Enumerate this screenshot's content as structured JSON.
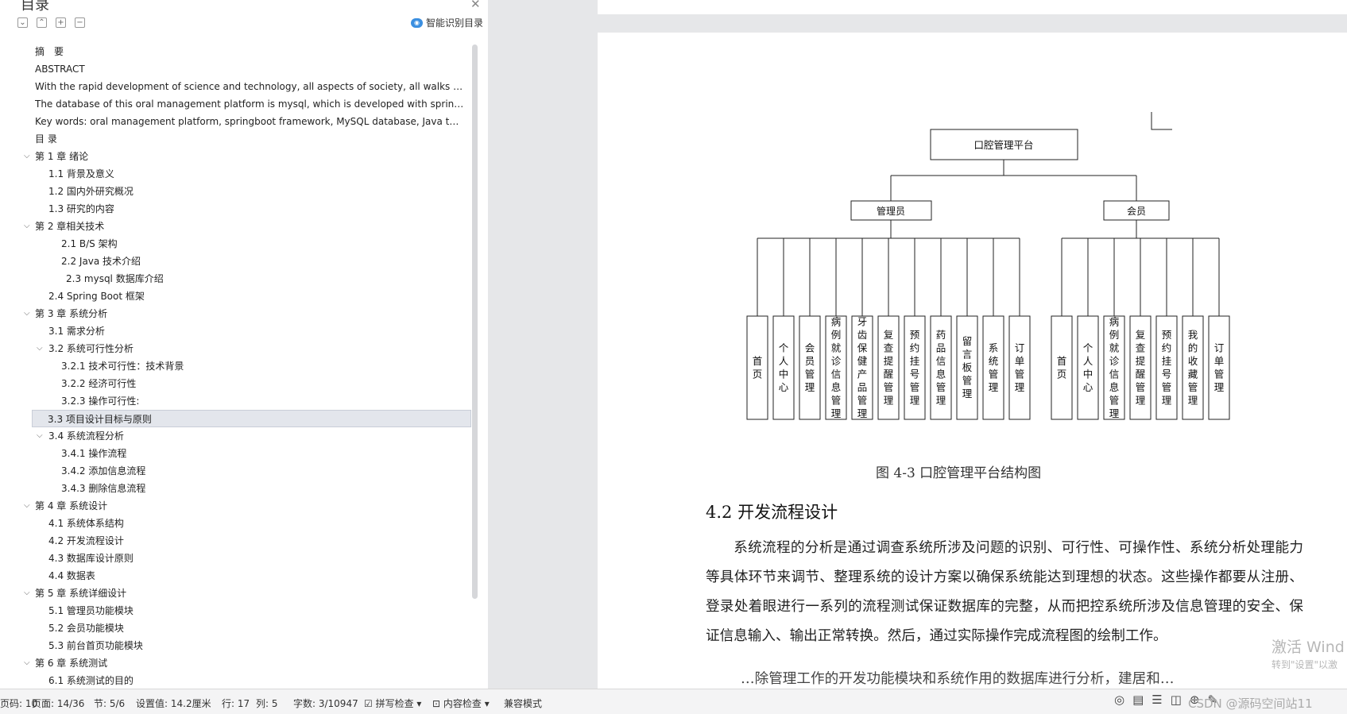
{
  "toc": {
    "title": "目录",
    "smart_label": "智能识别目录",
    "items": [
      {
        "label": "摘　要",
        "level": 0,
        "chev": false
      },
      {
        "label": "ABSTRACT",
        "level": 0,
        "chev": false
      },
      {
        "label": "With the rapid development of science and technology, all aspects of society, all walks of lif ...",
        "level": 0,
        "chev": false
      },
      {
        "label": "The database of this oral management platform is mysql, which is developed with springbo...",
        "level": 0,
        "chev": false
      },
      {
        "label": "Key words: oral management platform, springboot framework, MySQL database, Java techn...",
        "level": 0,
        "chev": false
      },
      {
        "label": "目 录",
        "level": 0,
        "chev": false
      },
      {
        "label": "第 1 章  绪论",
        "level": 0,
        "chev": true
      },
      {
        "label": "1.1 背景及意义",
        "level": 1,
        "chev": false
      },
      {
        "label": "1.2  国内外研究概况",
        "level": 1,
        "chev": false
      },
      {
        "label": "1.3  研究的内容",
        "level": 1,
        "chev": false
      },
      {
        "label": "第 2 章相关技术",
        "level": 0,
        "chev": true
      },
      {
        "label": "2.1    B/S 架构",
        "level": 2,
        "chev": false
      },
      {
        "label": "2.2    Java 技术介绍",
        "level": 2,
        "chev": false
      },
      {
        "label": "2.3 mysql 数据库介绍",
        "level": 3,
        "chev": false
      },
      {
        "label": "2.4 Spring    Boot 框架",
        "level": 1,
        "chev": false
      },
      {
        "label": "第 3 章  系统分析",
        "level": 0,
        "chev": true
      },
      {
        "label": "3.1  需求分析",
        "level": 1,
        "chev": false
      },
      {
        "label": "3.2  系统可行性分析",
        "level": 1,
        "chev": true
      },
      {
        "label": "3.2.1 技术可行性：技术背景",
        "level": 2,
        "chev": false
      },
      {
        "label": "3.2.2 经济可行性",
        "level": 2,
        "chev": false
      },
      {
        "label": "3.2.3 操作可行性:",
        "level": 2,
        "chev": false
      },
      {
        "label": "3.3  项目设计目标与原则",
        "level": 1,
        "chev": false,
        "sel": true
      },
      {
        "label": "3.4 系统流程分析",
        "level": 1,
        "chev": true
      },
      {
        "label": "3.4.1 操作流程",
        "level": 2,
        "chev": false
      },
      {
        "label": "3.4.2 添加信息流程",
        "level": 2,
        "chev": false
      },
      {
        "label": "3.4.3 删除信息流程",
        "level": 2,
        "chev": false
      },
      {
        "label": "第 4 章  系统设计",
        "level": 0,
        "chev": true
      },
      {
        "label": "4.1  系统体系结构",
        "level": 1,
        "chev": false
      },
      {
        "label": "4.2 开发流程设计",
        "level": 1,
        "chev": false
      },
      {
        "label": "4.3  数据库设计原则",
        "level": 1,
        "chev": false
      },
      {
        "label": "4.4  数据表",
        "level": 1,
        "chev": false
      },
      {
        "label": "第 5 章  系统详细设计",
        "level": 0,
        "chev": true
      },
      {
        "label": "5.1 管理员功能模块",
        "level": 1,
        "chev": false
      },
      {
        "label": "5.2 会员功能模块",
        "level": 1,
        "chev": false
      },
      {
        "label": "5.3 前台首页功能模块",
        "level": 1,
        "chev": false
      },
      {
        "label": "第 6 章    系统测试",
        "level": 0,
        "chev": true
      },
      {
        "label": "6.1 系统测试的目的",
        "level": 1,
        "chev": false
      }
    ]
  },
  "diagram": {
    "root": "口腔管理平台",
    "admin": "管理员",
    "member": "会员",
    "admin_leaves": [
      "首页",
      "个人中心",
      "会员管理",
      "病例就诊信息管理",
      "牙齿保健产品管理",
      "复查提醒管理",
      "预约挂号管理",
      "药品信息管理",
      "留言板管理",
      "系统管理",
      "订单管理"
    ],
    "member_leaves": [
      "首页",
      "个人中心",
      "病例就诊信息管理",
      "复查提醒管理",
      "预约挂号管理",
      "我的收藏管理",
      "订单管理"
    ]
  },
  "doc": {
    "caption": "图 4-3  口腔管理平台结构图",
    "section": "4.2 开发流程设计",
    "paragraph": "系统流程的分析是通过调查系统所涉及问题的识别、可行性、可操作性、系统分析处理能力等具体环节来调节、整理系统的设计方案以确保系统能达到理想的状态。这些操作都要从注册、登录处着眼进行一系列的流程测试保证数据库的完整，从而把控系统所涉及信息管理的安全、保证信息输入、输出正常转换。然后，通过实际操作完成流程图的绘制工作。",
    "paragraph_next": "…除管理工作的开发功能模块和系统作用的数据库进行分析，建居和…"
  },
  "watermark": {
    "line1": "激活 Wind",
    "line2": "转到\"设置\"以激"
  },
  "status": {
    "page_no": "页码: 10",
    "page": "页面: 14/36",
    "section": "节: 5/6",
    "setting": "设置值: 14.2厘米",
    "row": "行: 17",
    "col": "列: 5",
    "words": "字数: 3/10947",
    "spell": "拼写检查",
    "content": "内容检查",
    "compat": "兼容模式",
    "csdn": "CSDN @源码空间站11"
  }
}
